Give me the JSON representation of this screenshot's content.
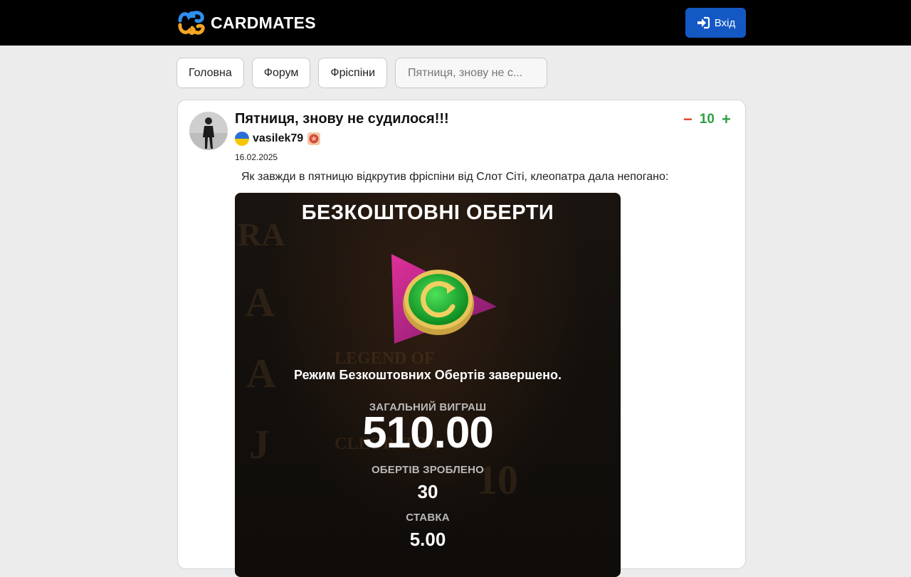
{
  "header": {
    "brand": "CARDMATES",
    "login_label": "Вхід"
  },
  "nav": {
    "items": [
      "Головна",
      "Форум",
      "Фріспіни"
    ],
    "current": "Пятниця, знову не с..."
  },
  "post": {
    "title": "Пятниця, знову не судилося!!!",
    "author": "vasilek79",
    "date": "16.02.2025",
    "score": "10",
    "vote_minus": "−",
    "vote_plus": "+",
    "body": "Як завжди в пятницю відкрутив фріспіни від Слот Сіті, клеопатра дала непогано:"
  },
  "screenshot": {
    "heading": "БЕЗКОШТОВНІ ОБЕРТИ",
    "complete_text": "Режим Безкоштовних Обертів завершено.",
    "total_win_label": "ЗАГАЛЬНИЙ ВИГРАШ",
    "total_win_value": "510.00",
    "spins_label": "ОБЕРТІВ ЗРОБЛЕНО",
    "spins_value": "30",
    "bet_label": "СТАВКА",
    "bet_value": "5.00"
  },
  "colors": {
    "brand_blue": "#1458c4",
    "vote_minus": "#e0402a",
    "vote_plus": "#2ea043"
  },
  "icons": [
    "cardmates-logo-icon",
    "sign-in-icon",
    "ukraine-flag-icon",
    "rank-badge-icon",
    "free-spins-icon"
  ]
}
